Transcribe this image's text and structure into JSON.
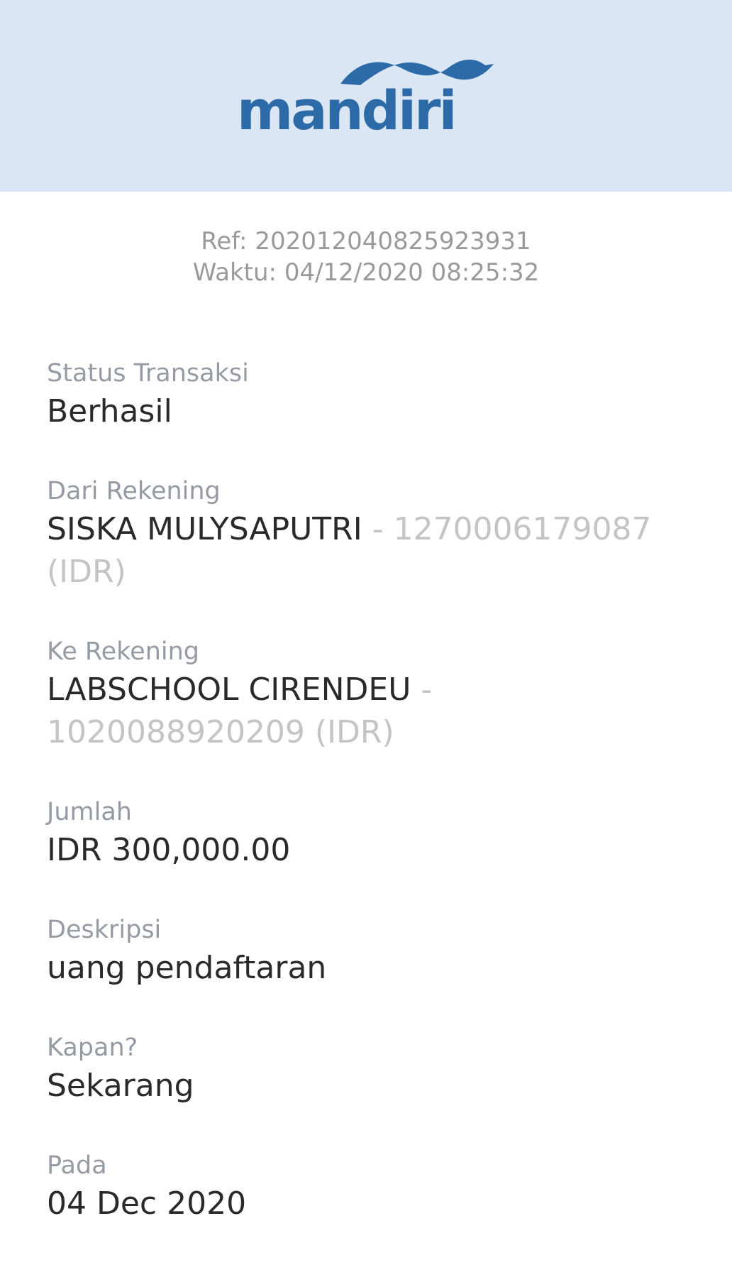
{
  "brand": {
    "name": "mandiri",
    "color": "#2d6ba8",
    "header_bg": "#dae6f3",
    "logo_icon": "mandiri-wave-logo"
  },
  "meta": {
    "ref": "Ref: 202012040825923931",
    "time": "Waktu: 04/12/2020 08:25:32"
  },
  "fields": {
    "status": {
      "label": "Status Transaksi",
      "value": "Berhasil"
    },
    "from": {
      "label": "Dari Rekening",
      "name": "SISKA MULYSAPUTRI",
      "account": " - 1270006179087 (IDR)"
    },
    "to": {
      "label": "Ke Rekening",
      "name": "LABSCHOOL CIRENDEU",
      "account": " - 1020088920209 (IDR)"
    },
    "amount": {
      "label": "Jumlah",
      "value": "IDR 300,000.00"
    },
    "description": {
      "label": "Deskripsi",
      "value": "uang pendaftaran"
    },
    "when": {
      "label": "Kapan?",
      "value": "Sekarang"
    },
    "date": {
      "label": "Pada",
      "value": "04 Dec 2020"
    }
  }
}
